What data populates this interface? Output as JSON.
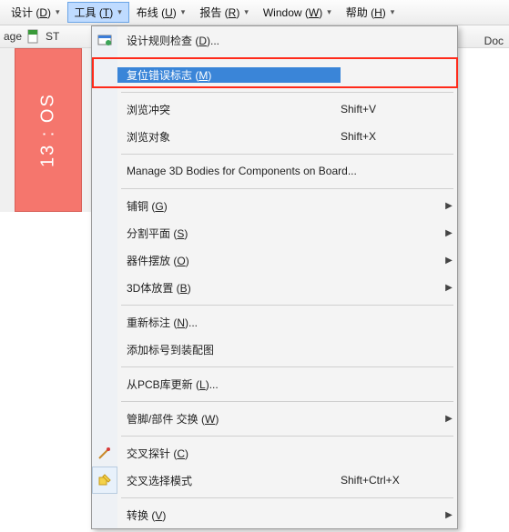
{
  "menubar": {
    "design": {
      "label": "设计 (",
      "accel": "D",
      "after": ")"
    },
    "tools": {
      "label": "工具 (",
      "accel": "T",
      "after": ")"
    },
    "route": {
      "label": "布线 (",
      "accel": "U",
      "after": ")"
    },
    "report": {
      "label": "报告 (",
      "accel": "R",
      "after": ")"
    },
    "window": {
      "label": "Window (",
      "accel": "W",
      "after": ")"
    },
    "help": {
      "label": "帮助 (",
      "accel": "H",
      "after": ")"
    }
  },
  "toolbar": {
    "tab_age": "age",
    "tab_st": "ST"
  },
  "doc_right": "Doc",
  "red_panel_text": "13 : OS",
  "menu": {
    "design_rule_check": {
      "label": "设计规则检查 (",
      "accel": "D",
      "after": ")..."
    },
    "reset_error_markers": {
      "label": "复位错误标志 (",
      "accel": "M",
      "after": ")"
    },
    "browse_violations": {
      "label": "浏览冲突",
      "shortcut": "Shift+V"
    },
    "browse_objects": {
      "label": "浏览对象",
      "shortcut": "Shift+X"
    },
    "manage_3d_bodies": {
      "label": "Manage 3D Bodies for Components on Board..."
    },
    "polygon_pours": {
      "label": "铺铜 (",
      "accel": "G",
      "after": ")"
    },
    "split_planes": {
      "label": "分割平面 (",
      "accel": "S",
      "after": ")"
    },
    "component_placement": {
      "label": "器件摆放 (",
      "accel": "O",
      "after": ")"
    },
    "3d_body_placement": {
      "label": "3D体放置 (",
      "accel": "B",
      "after": ")"
    },
    "reannotate": {
      "label": "重新标注 (",
      "accel": "N",
      "after": ")..."
    },
    "add_designators": {
      "label": "添加标号到装配图"
    },
    "update_from_pcb": {
      "label": "从PCB库更新 (",
      "accel": "L",
      "after": ")..."
    },
    "pin_part_swap": {
      "label": "管脚/部件 交换 (",
      "accel": "W",
      "after": ")"
    },
    "cross_probe": {
      "label": "交叉探针 (",
      "accel": "C",
      "after": ")"
    },
    "cross_select": {
      "label": "交叉选择模式",
      "shortcut": "Shift+Ctrl+X"
    },
    "convert": {
      "label": "转换 (",
      "accel": "V",
      "after": ")"
    }
  }
}
